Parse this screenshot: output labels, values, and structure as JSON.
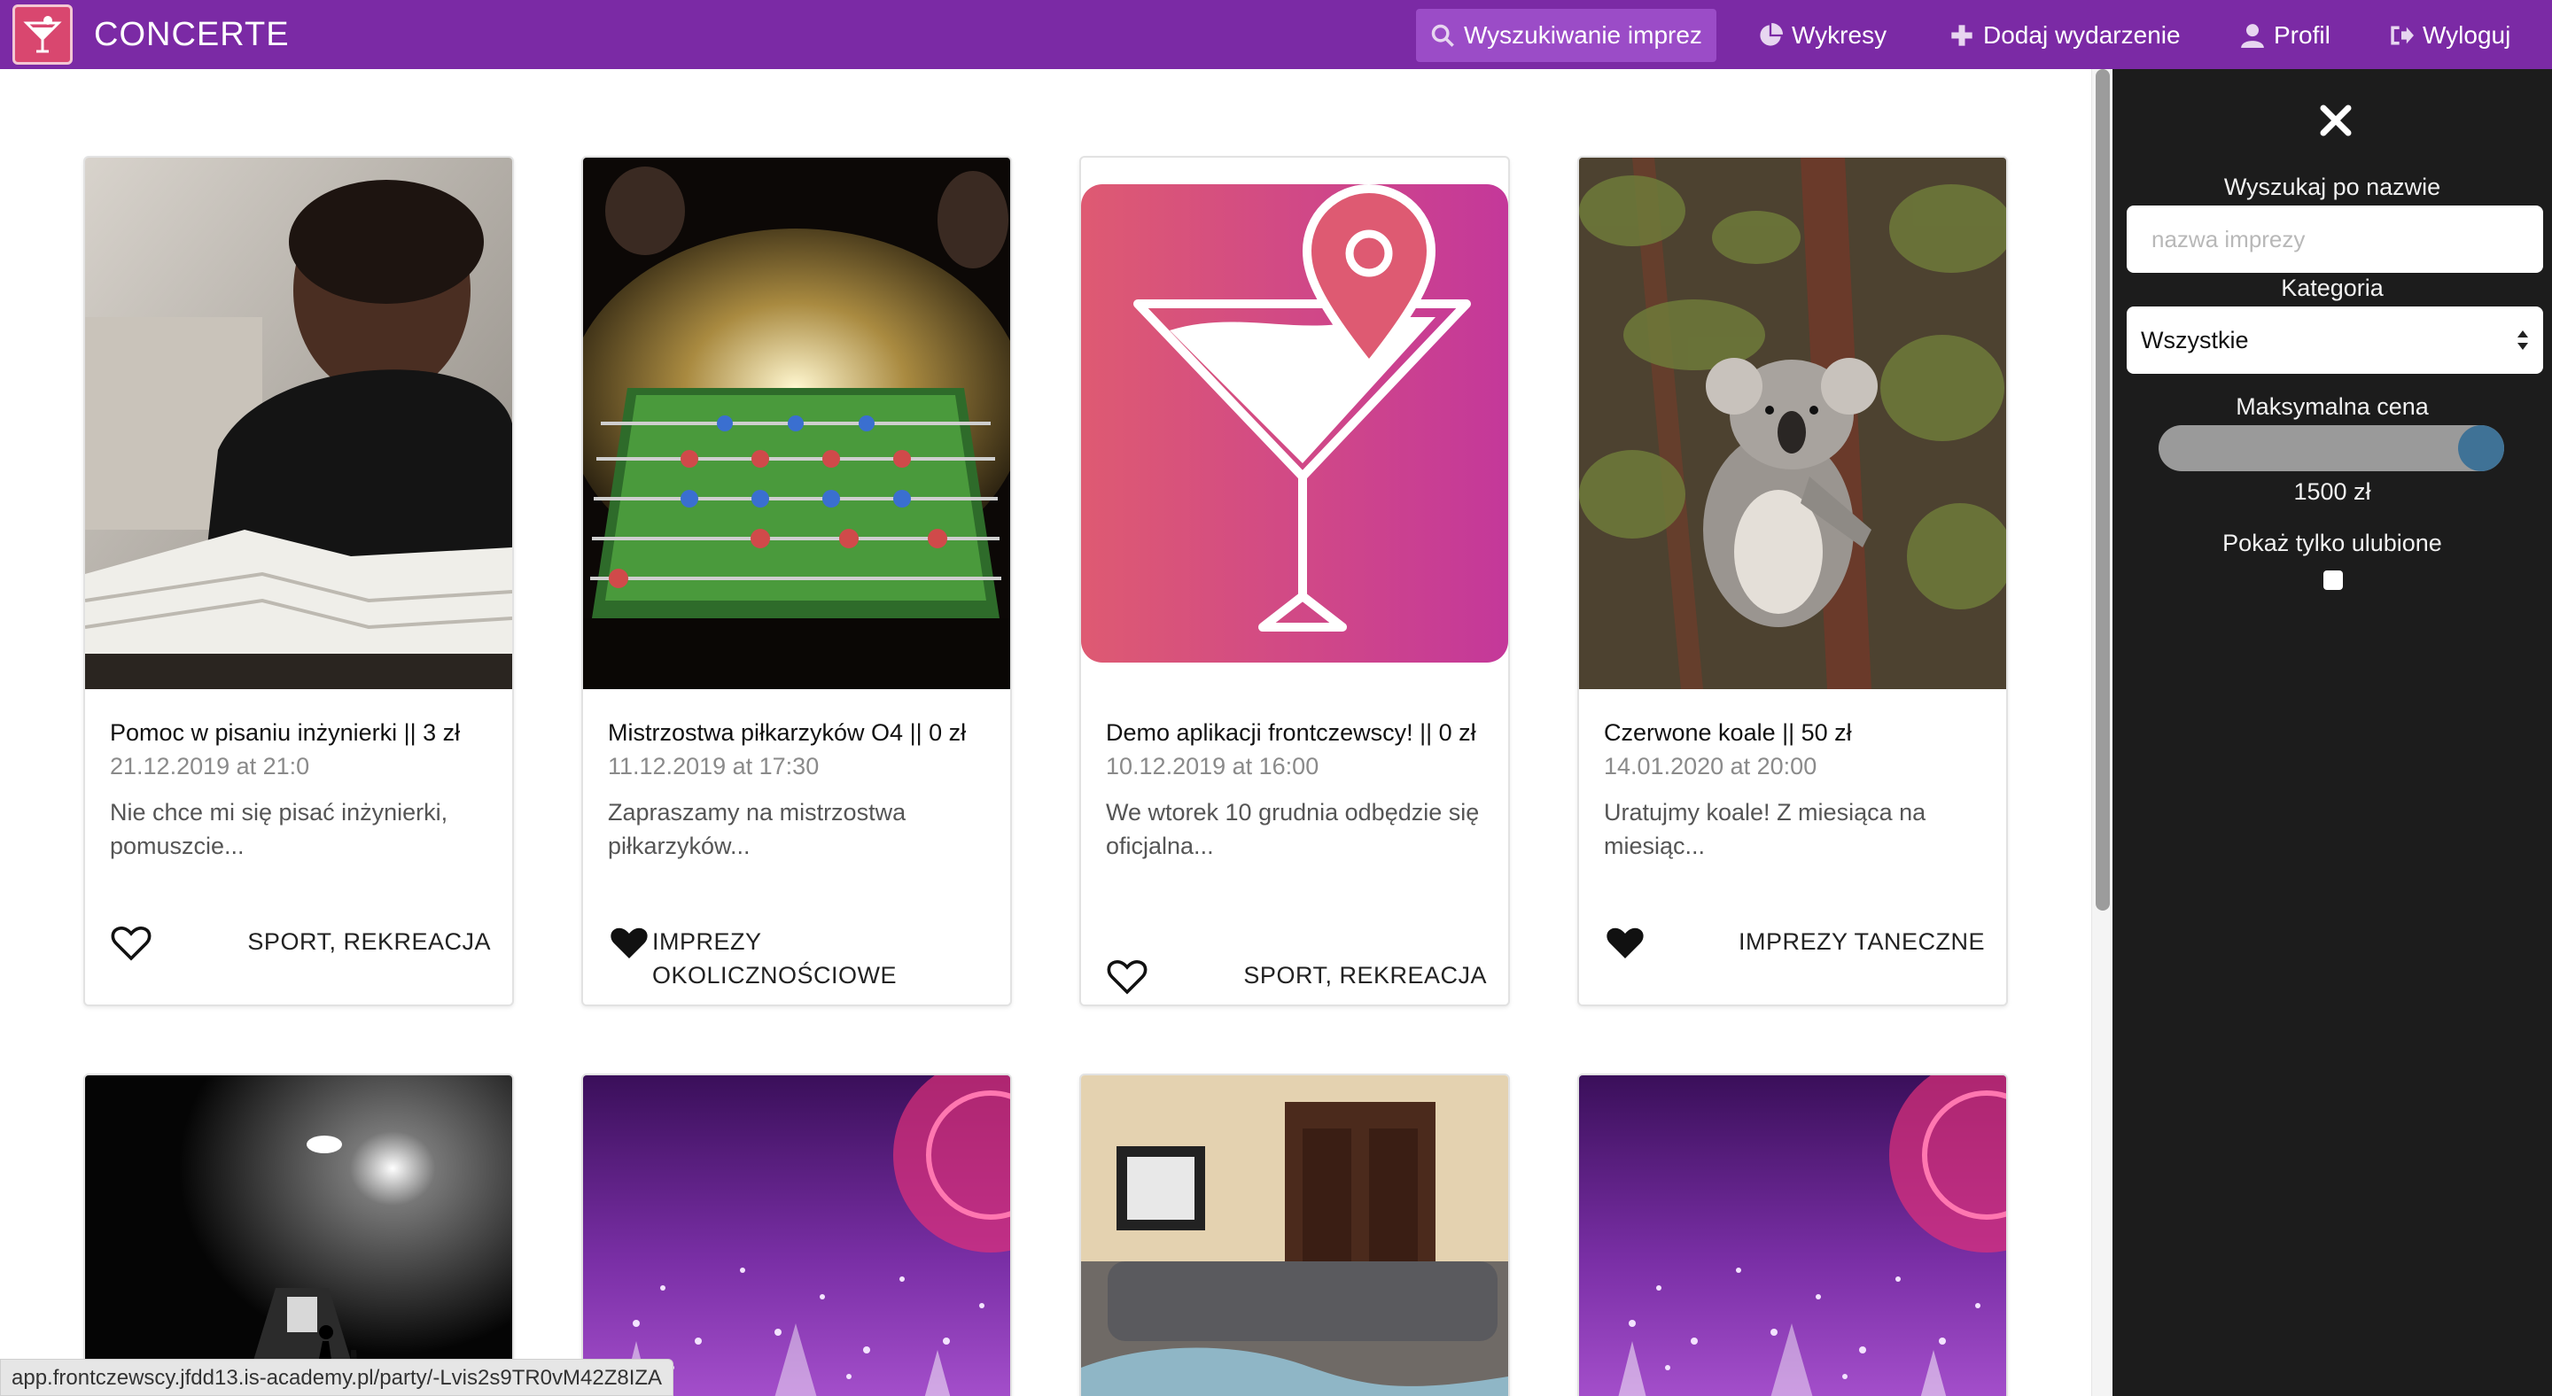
{
  "app": {
    "brand": "CONCERTE"
  },
  "nav": {
    "items": [
      {
        "label": "Wyszukiwanie imprez",
        "icon": "search-icon",
        "active": true
      },
      {
        "label": "Wykresy",
        "icon": "pie-chart-icon",
        "active": false
      },
      {
        "label": "Dodaj wydarzenie",
        "icon": "plus-icon",
        "active": false
      },
      {
        "label": "Profil",
        "icon": "user-icon",
        "active": false
      },
      {
        "label": "Wyloguj",
        "icon": "logout-icon",
        "active": false
      }
    ]
  },
  "cards": [
    {
      "title": "Pomoc w pisaniu inżynierki || 3 zł",
      "date": "21.12.2019 at 21:0",
      "desc": "Nie chce mi się pisać inżynierki, pomuszcie...",
      "category": "SPORT, REKREACJA",
      "favorite": false
    },
    {
      "title": "Mistrzostwa piłkarzyków O4 || 0 zł",
      "date": "11.12.2019 at 17:30",
      "desc": "Zapraszamy na mistrzostwa piłkarzyków...",
      "category": "IMPREZY OKOLICZNOŚCIOWE",
      "favorite": true
    },
    {
      "title": "Demo aplikacji frontczewscy! || 0 zł",
      "date": "10.12.2019 at 16:00",
      "desc": "We wtorek 10 grudnia odbędzie się oficjalna...",
      "category": "SPORT, REKREACJA",
      "favorite": false
    },
    {
      "title": "Czerwone koale || 50 zł",
      "date": "14.01.2020 at 20:00",
      "desc": "Uratujmy koale! Z miesiąca na miesiąc...",
      "category": "IMPREZY TANECZNE",
      "favorite": true
    }
  ],
  "sidebar": {
    "search_label": "Wyszukaj po nazwie",
    "search_placeholder": "nazwa imprezy",
    "search_value": "",
    "category_label": "Kategoria",
    "category_value": "Wszystkie",
    "price_label": "Maksymalna cena",
    "price_value": "1500 zł",
    "price_fraction": 1.0,
    "favorites_label": "Pokaż tylko ulubione",
    "favorites_checked": false
  },
  "status_bar": {
    "url": "app.frontczewscy.jfdd13.is-academy.pl/party/-Lvis2s9TR0vM42Z8IZA"
  },
  "colors": {
    "navbar": "#7b2aa5",
    "sidebar": "#1c1c1c",
    "slider_thumb": "#3f7296",
    "brand_logo": "#d9476f"
  }
}
